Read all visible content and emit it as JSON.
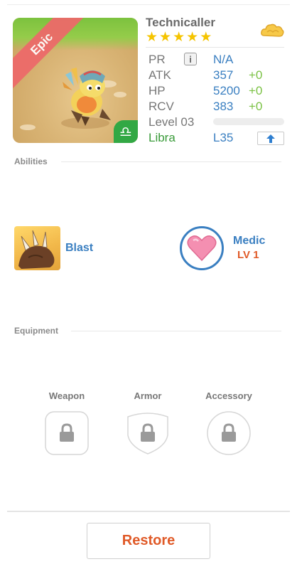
{
  "monster": {
    "name": "Technicaller",
    "rarity": "Epic",
    "star_count": 5,
    "zodiac_icon": "libra-icon",
    "currency_icon": "golden-cloud-icon"
  },
  "stats": {
    "pr": {
      "label": "PR",
      "value": "N/A"
    },
    "atk": {
      "label": "ATK",
      "value": "357",
      "bonus": "+0"
    },
    "hp": {
      "label": "HP",
      "value": "5200",
      "bonus": "+0"
    },
    "rcv": {
      "label": "RCV",
      "value": "383",
      "bonus": "+0"
    },
    "level": {
      "label": "Level 03",
      "progress": 0.0
    },
    "zodiac": {
      "label": "Libra",
      "value": "L35"
    }
  },
  "abilities": {
    "title": "Abilities",
    "attack": {
      "name": "Blast",
      "icon": "claw-icon"
    },
    "skill": {
      "name": "Medic",
      "level": "LV 1",
      "icon": "heart-icon"
    }
  },
  "equipment": {
    "title": "Equipment",
    "slots": [
      {
        "label": "Weapon",
        "locked": true
      },
      {
        "label": "Armor",
        "locked": true
      },
      {
        "label": "Accessory",
        "locked": true
      }
    ]
  },
  "actions": {
    "restore_label": "Restore"
  },
  "colors": {
    "accent_blue": "#3a7fc1",
    "accent_green": "#7ac143",
    "accent_orange": "#e05a28",
    "epic_ribbon": "#ec6a6a",
    "star": "#f5c400"
  }
}
